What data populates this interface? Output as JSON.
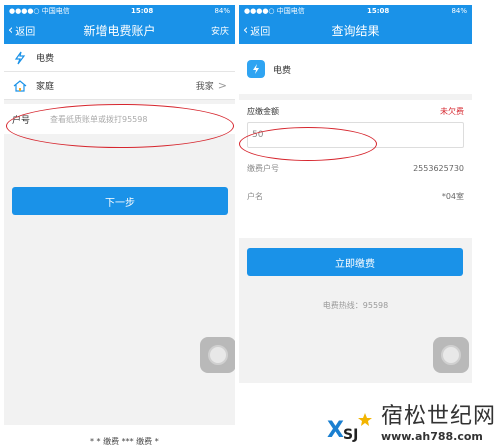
{
  "left": {
    "status": {
      "carrier": "●●●●○ 中国电信",
      "wifi": "WiFi",
      "time": "15:08",
      "battery": "84%"
    },
    "nav": {
      "back": "返回",
      "title": "新增电费账户",
      "right": "安庆"
    },
    "rows": [
      {
        "icon": "lightning-icon",
        "label": "电费",
        "value": ""
      },
      {
        "icon": "house-icon",
        "label": "家庭",
        "value": "我家"
      }
    ],
    "account_input": {
      "label": "户号",
      "placeholder": "查看纸质账单或拨打95598"
    },
    "next_button": "下一步"
  },
  "right": {
    "status": {
      "carrier": "●●●●○ 中国电信",
      "wifi": "WiFi",
      "time": "15:08",
      "battery": "84%"
    },
    "nav": {
      "back": "返回",
      "title": "查询结果"
    },
    "service": {
      "icon": "lightning-icon",
      "label": "电费"
    },
    "amount": {
      "label": "应缴金额",
      "status": "未欠费",
      "value": "50"
    },
    "account": {
      "label": "缴费户号",
      "value": "2553625730"
    },
    "name": {
      "label": "户名",
      "value": "*04室"
    },
    "pay_button": "立即缴费",
    "hotline": "电费热线：95598"
  },
  "watermark": {
    "logo": "XSJ",
    "name": "宿松世纪网",
    "url": "www.ah788.com"
  },
  "caption": "* * 缴费 *** 缴费 *",
  "colors": {
    "primary": "#1a92e8",
    "alert": "#d6262e"
  }
}
